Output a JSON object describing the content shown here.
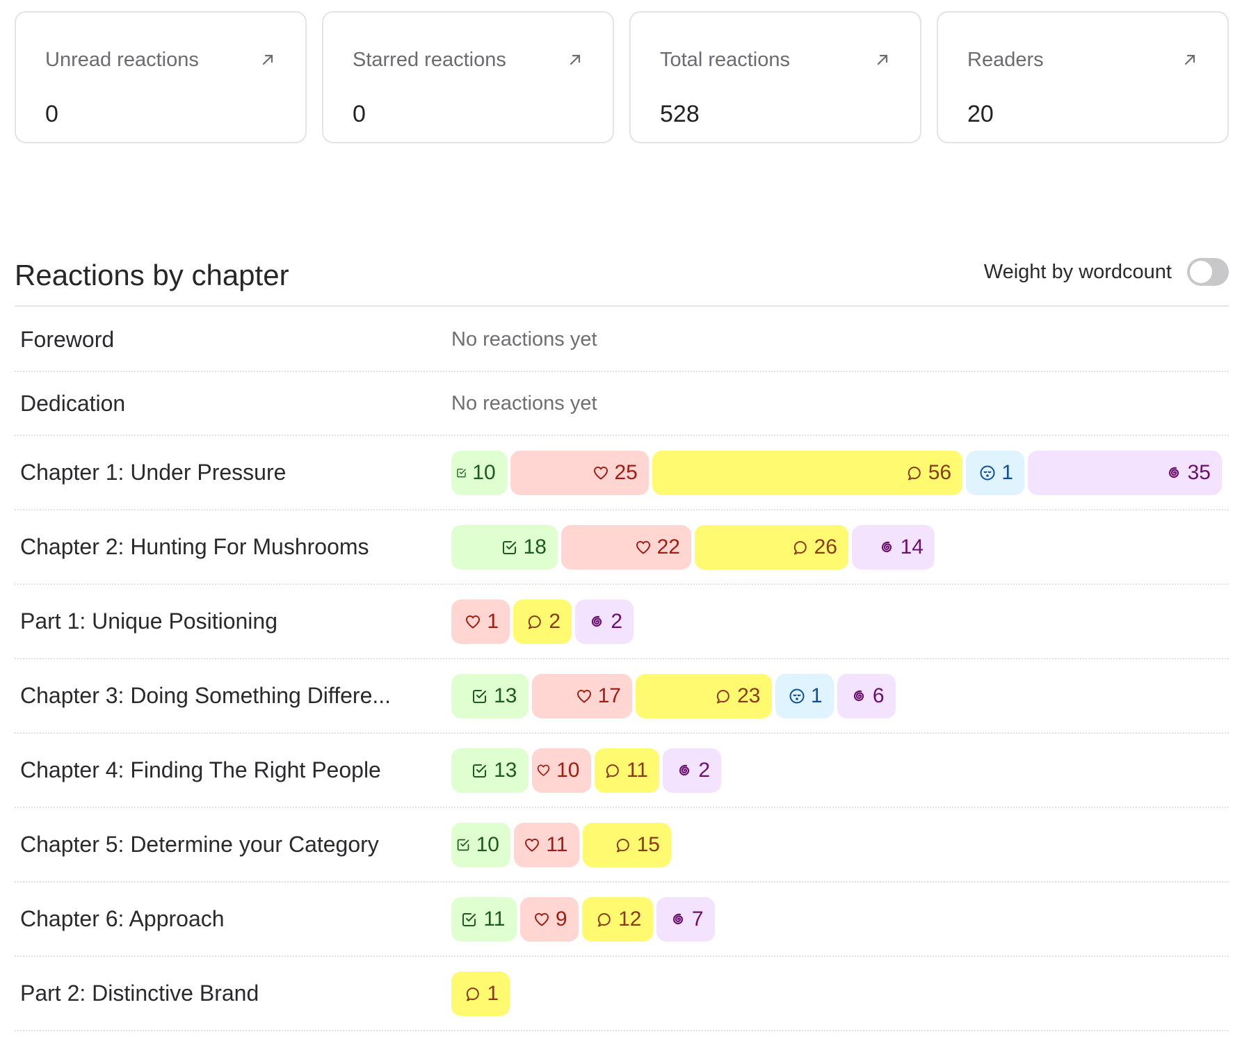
{
  "stats": [
    {
      "label": "Unread reactions",
      "value": "0",
      "icon": "arrow-up-right-icon"
    },
    {
      "label": "Starred reactions",
      "value": "0",
      "icon": "arrow-up-right-icon"
    },
    {
      "label": "Total reactions",
      "value": "528",
      "icon": "arrow-up-right-icon"
    },
    {
      "label": "Readers",
      "value": "20",
      "icon": "arrow-up-right-icon"
    }
  ],
  "section": {
    "title": "Reactions by chapter",
    "weight_toggle_label": "Weight by wordcount",
    "weight_toggle_on": false,
    "empty_text": "No reactions yet"
  },
  "reaction_types": {
    "agree": {
      "icon": "checkbox-icon",
      "bg": "#dfffd0",
      "fg": "#1c5a1f"
    },
    "love": {
      "icon": "heart-icon",
      "bg": "#ffd6d2",
      "fg": "#a31c12"
    },
    "comment": {
      "icon": "speech-bubble-icon",
      "bg": "#fffa70",
      "fg": "#8a3a10"
    },
    "bored": {
      "icon": "sleepy-face-icon",
      "bg": "#dff4ff",
      "fg": "#0e4f96"
    },
    "confused": {
      "icon": "spiral-icon",
      "bg": "#f3e3ff",
      "fg": "#6a0f6e"
    }
  },
  "chapters": [
    {
      "title": "Foreword",
      "reactions": []
    },
    {
      "title": "Dedication",
      "reactions": []
    },
    {
      "title": "Chapter 1: Under Pressure",
      "reactions": [
        {
          "type": "agree",
          "count": 10
        },
        {
          "type": "love",
          "count": 25
        },
        {
          "type": "comment",
          "count": 56
        },
        {
          "type": "bored",
          "count": 1
        },
        {
          "type": "confused",
          "count": 35
        }
      ]
    },
    {
      "title": "Chapter 2: Hunting For Mushrooms",
      "reactions": [
        {
          "type": "agree",
          "count": 18
        },
        {
          "type": "love",
          "count": 22
        },
        {
          "type": "comment",
          "count": 26
        },
        {
          "type": "confused",
          "count": 14
        }
      ]
    },
    {
      "title": "Part 1: Unique Positioning",
      "reactions": [
        {
          "type": "love",
          "count": 1
        },
        {
          "type": "comment",
          "count": 2
        },
        {
          "type": "confused",
          "count": 2
        }
      ]
    },
    {
      "title": "Chapter 3: Doing Something Differe...",
      "reactions": [
        {
          "type": "agree",
          "count": 13
        },
        {
          "type": "love",
          "count": 17
        },
        {
          "type": "comment",
          "count": 23
        },
        {
          "type": "bored",
          "count": 1
        },
        {
          "type": "confused",
          "count": 6
        }
      ]
    },
    {
      "title": "Chapter 4: Finding The Right People",
      "reactions": [
        {
          "type": "agree",
          "count": 13
        },
        {
          "type": "love",
          "count": 10
        },
        {
          "type": "comment",
          "count": 11
        },
        {
          "type": "confused",
          "count": 2
        }
      ]
    },
    {
      "title": "Chapter 5: Determine your Category",
      "reactions": [
        {
          "type": "agree",
          "count": 10
        },
        {
          "type": "love",
          "count": 11
        },
        {
          "type": "comment",
          "count": 15
        }
      ]
    },
    {
      "title": "Chapter 6: Approach",
      "reactions": [
        {
          "type": "agree",
          "count": 11
        },
        {
          "type": "love",
          "count": 9
        },
        {
          "type": "comment",
          "count": 12
        },
        {
          "type": "confused",
          "count": 7
        }
      ]
    },
    {
      "title": "Part 2: Distinctive Brand",
      "reactions": [
        {
          "type": "comment",
          "count": 1
        }
      ]
    }
  ]
}
